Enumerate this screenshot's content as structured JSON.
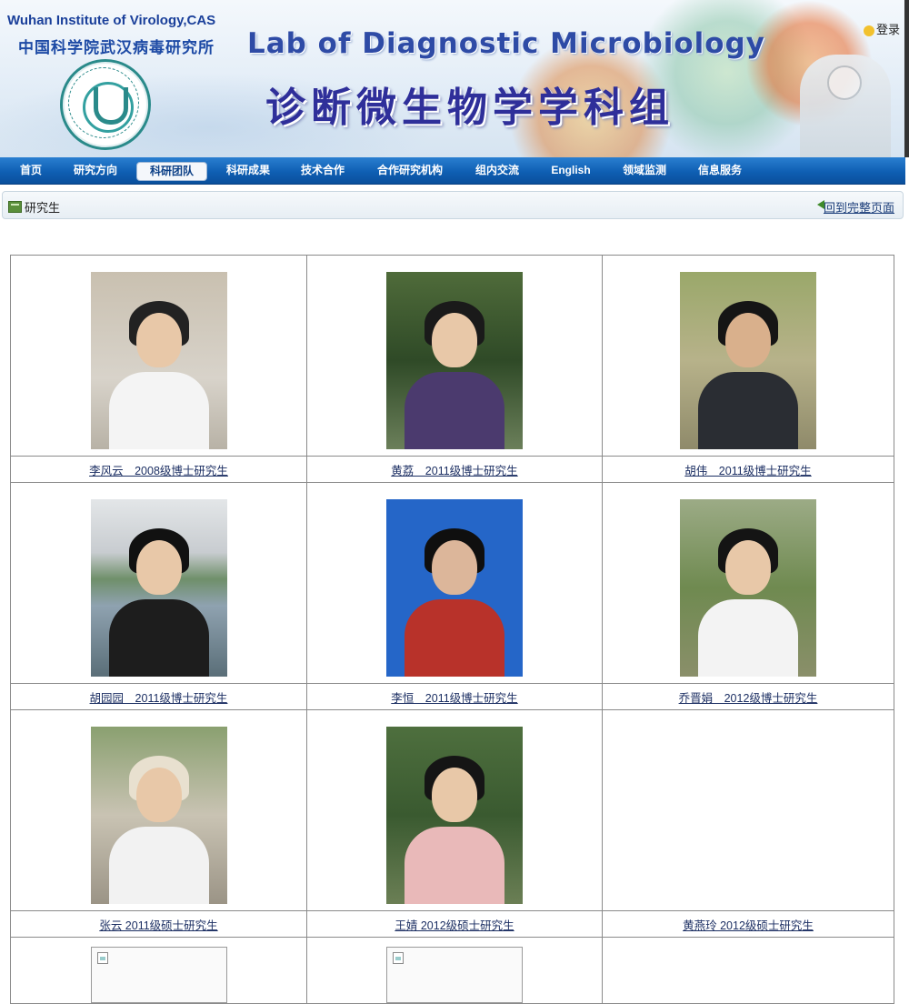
{
  "banner": {
    "institute_en": "Wuhan Institute of Virology,CAS",
    "institute_cn": "中国科学院武汉病毒研究所",
    "lab_en": "Lab of Diagnostic Microbiology",
    "lab_cn": "诊断微生物学学科组",
    "login_label": "登录"
  },
  "nav": {
    "items": [
      {
        "label": "首页"
      },
      {
        "label": "研究方向"
      },
      {
        "label": "科研团队"
      },
      {
        "label": "科研成果"
      },
      {
        "label": "技术合作"
      },
      {
        "label": "合作研究机构"
      },
      {
        "label": "组内交流"
      },
      {
        "label": "English"
      },
      {
        "label": "领域监测"
      },
      {
        "label": "信息服务"
      }
    ],
    "active": "科研团队"
  },
  "breadcrumb": {
    "title": "研究生",
    "back_link": "回到完整页面"
  },
  "students": [
    {
      "caption": "李风云　2008级博士研究生",
      "photo": "student-photo"
    },
    {
      "caption": "黄荔　2011级博士研究生",
      "photo": "student-photo"
    },
    {
      "caption": "胡伟　2011级博士研究生",
      "photo": "student-photo"
    },
    {
      "caption": "胡园园　2011级博士研究生",
      "photo": "student-photo"
    },
    {
      "caption": "李恒　2011级博士研究生",
      "photo": "student-photo"
    },
    {
      "caption": "乔晋娟　2012级博士研究生",
      "photo": "student-photo"
    },
    {
      "caption": "张云 2011级硕士研究生",
      "photo": "student-photo"
    },
    {
      "caption": "王婧 2012级硕士研究生",
      "photo": "student-photo"
    },
    {
      "caption": "黄燕玲 2012级硕士研究生",
      "photo": "none"
    }
  ],
  "colors": {
    "nav_bg": "#0f5fb3",
    "link": "#1c2f63",
    "title_blue": "#2e4ba6"
  }
}
